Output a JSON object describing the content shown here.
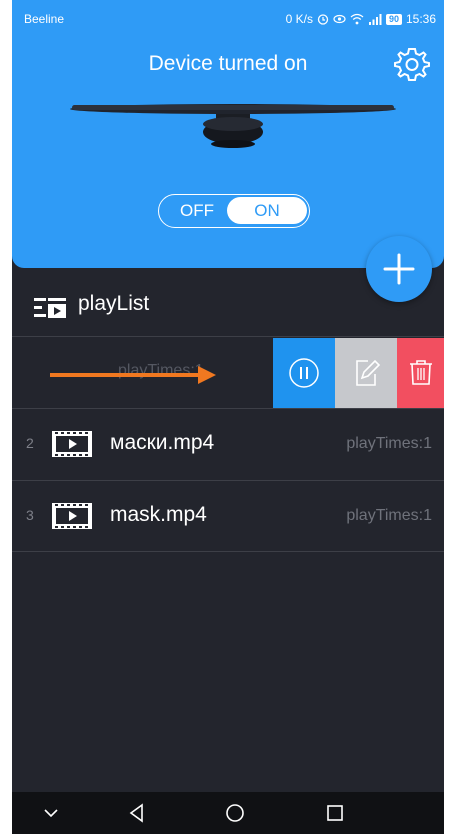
{
  "status_bar": {
    "carrier": "Beeline",
    "speed": "0 K/s",
    "battery": "90",
    "time": "15:36"
  },
  "header": {
    "title": "Device turned on",
    "settings_icon": "gear-icon"
  },
  "power_toggle": {
    "off_label": "OFF",
    "on_label": "ON",
    "state": "ON"
  },
  "add_button_icon": "plus-icon",
  "playlist": {
    "title": "playList",
    "items": [
      {
        "number": "",
        "name": "",
        "times": "playTimes:1",
        "swiped": true,
        "actions": [
          "pause-icon",
          "edit-icon",
          "trash-icon"
        ]
      },
      {
        "number": "2",
        "name": "маски.mp4",
        "times": "playTimes:1"
      },
      {
        "number": "3",
        "name": "mask.mp4",
        "times": "playTimes:1"
      }
    ]
  },
  "colors": {
    "header_blue": "#2f9bf6",
    "list_bg": "#23252d",
    "annotation_arrow": "#f07820",
    "pause_blue": "#1f93ef",
    "edit_gray": "#c6c8cc",
    "delete_red": "#f24f60"
  },
  "nav_bar": [
    "chevron-down-icon",
    "back-icon",
    "home-icon",
    "recents-icon"
  ]
}
